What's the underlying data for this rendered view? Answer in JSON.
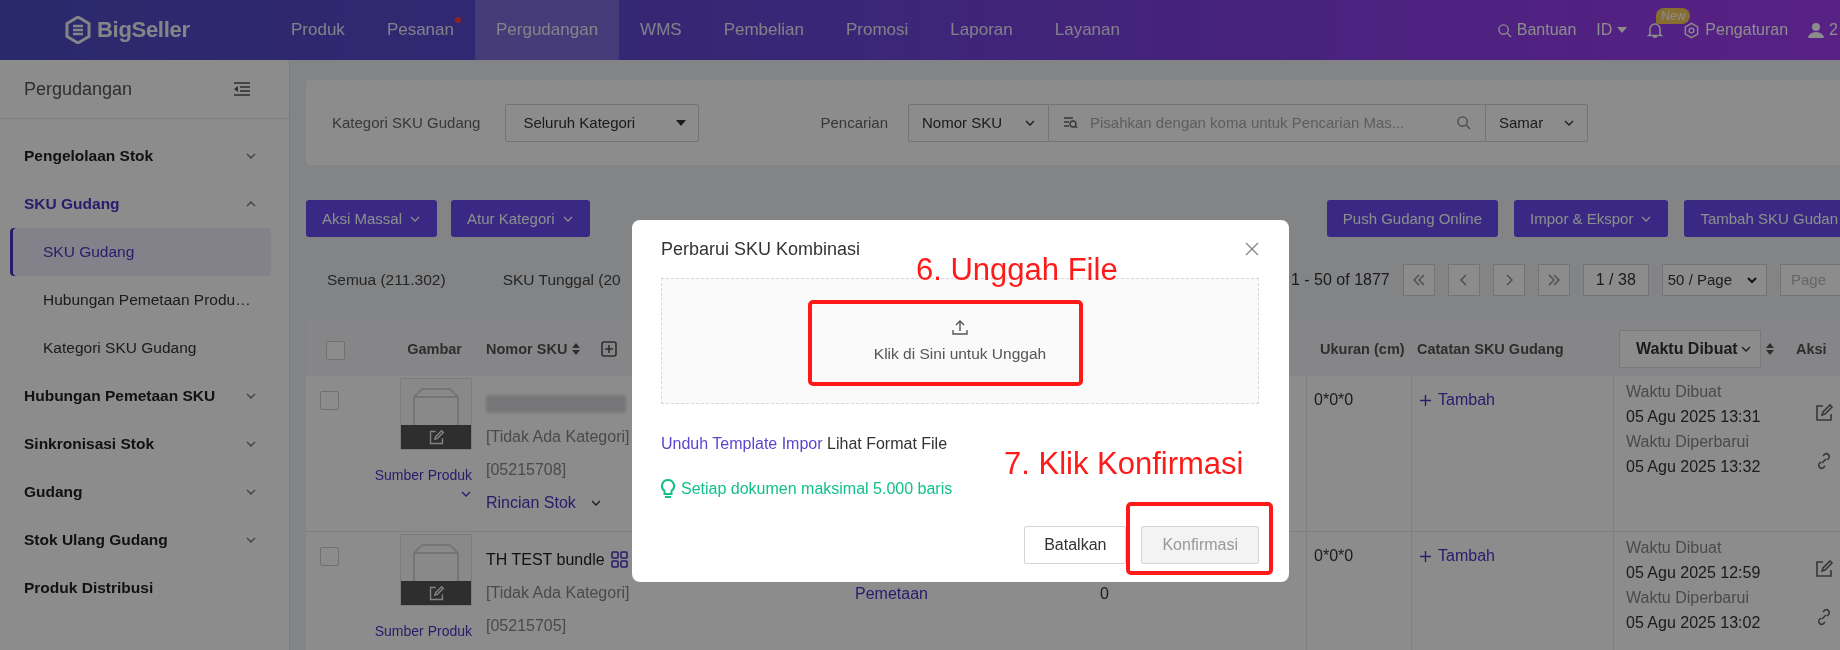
{
  "topbar": {
    "logo": "BigSeller",
    "nav": [
      {
        "label": "Produk",
        "selected": false,
        "dot": false
      },
      {
        "label": "Pesanan",
        "selected": false,
        "dot": true
      },
      {
        "label": "Pergudangan",
        "selected": true,
        "dot": false
      },
      {
        "label": "WMS",
        "selected": false,
        "dot": false
      },
      {
        "label": "Pembelian",
        "selected": false,
        "dot": false
      },
      {
        "label": "Promosi",
        "selected": false,
        "dot": false
      },
      {
        "label": "Laporan",
        "selected": false,
        "dot": false
      },
      {
        "label": "Layanan",
        "selected": false,
        "dot": false
      }
    ],
    "help": "Bantuan",
    "language": "ID",
    "notification_badge": "New",
    "settings": "Pengaturan",
    "user": "2"
  },
  "sidebar": {
    "title": "Pergudangan",
    "items": [
      {
        "label": "Pengelolaan Stok",
        "kind": "group",
        "expanded": false,
        "selected": false
      },
      {
        "label": "SKU Gudang",
        "kind": "group",
        "expanded": true,
        "selected": true,
        "children": [
          {
            "label": "SKU Gudang",
            "selected": true
          },
          {
            "label": "Hubungan Pemetaan Produ…",
            "selected": false
          },
          {
            "label": "Kategori SKU Gudang",
            "selected": false
          }
        ]
      },
      {
        "label": "Hubungan Pemetaan SKU",
        "kind": "group",
        "expanded": false,
        "selected": false
      },
      {
        "label": "Sinkronisasi Stok",
        "kind": "group",
        "expanded": false,
        "selected": false
      },
      {
        "label": "Gudang",
        "kind": "group",
        "expanded": false,
        "selected": false
      },
      {
        "label": "Stok Ulang Gudang",
        "kind": "group",
        "expanded": false,
        "selected": false
      },
      {
        "label": "Produk Distribusi",
        "kind": "link",
        "selected": false
      }
    ]
  },
  "filter": {
    "category": {
      "label": "Kategori SKU Gudang",
      "value": "Seluruh Kategori"
    },
    "search": {
      "label": "Pencarian",
      "field": "Nomor SKU",
      "placeholder": "Pisahkan dengan koma untuk Pencarian Mas...",
      "match": "Samar"
    }
  },
  "toolbar": {
    "left": [
      {
        "label": "Aksi Massal",
        "dropdown": true
      },
      {
        "label": "Atur Kategori",
        "dropdown": true
      }
    ],
    "right": [
      {
        "label": "Push Gudang Online",
        "dropdown": false
      },
      {
        "label": "Impor & Ekspor",
        "dropdown": true
      },
      {
        "label": "Tambah SKU Gudan",
        "dropdown": false
      }
    ]
  },
  "tabs": [
    {
      "label": "Semua (211.302)"
    },
    {
      "label": "SKU Tunggal (20"
    }
  ],
  "pagination": {
    "range": "1 - 50 of 1877",
    "page": "1 / 38",
    "page_size": "50 / Page",
    "jump_placeholder": "Page"
  },
  "table": {
    "all_checked": false,
    "columns": [
      {
        "kind": "image",
        "label": "Gambar",
        "sortable": false
      },
      {
        "kind": "sku",
        "label": "Nomor SKU",
        "sortable": true
      },
      {
        "kind": "size",
        "label": "Ukuran (cm)",
        "sortable": false
      },
      {
        "kind": "note",
        "label": "Catatan SKU Gudang",
        "sortable": false
      },
      {
        "kind": "time",
        "label": "Waktu Dibuat",
        "sortable": true
      },
      {
        "kind": "action",
        "label": "Aksi",
        "sortable": false
      }
    ],
    "rows": [
      {
        "checked": false,
        "source_link": "Sumber Produk",
        "source_expandable": true,
        "category": "[Tidak Ada Kategori]",
        "code": "[05215708]",
        "stock_link": "Rincian Stok",
        "size": "0*0*0",
        "note_action": "Tambah",
        "times": [
          {
            "label": "Waktu Dibuat",
            "value": "05 Agu 2025 13:31"
          },
          {
            "label": "Waktu Diperbarui",
            "value": "05 Agu 2025 13:32"
          }
        ]
      },
      {
        "checked": false,
        "source_link": "Sumber Produk",
        "source_expandable": false,
        "name": "TH TEST bundle",
        "category": "[Tidak Ada Kategori]",
        "code": "[05215705]",
        "column_5": "Pemetaan",
        "column_6": "0",
        "size": "0*0*0",
        "note_action": "Tambah",
        "times": [
          {
            "label": "Waktu Dibuat",
            "value": "05 Agu 2025 12:59"
          },
          {
            "label": "Waktu Diperbarui",
            "value": "05 Agu 2025 13:02"
          }
        ]
      }
    ]
  },
  "modal": {
    "title": "Perbarui SKU Kombinasi",
    "upload_label": "Klik di Sini untuk Unggah",
    "template_link": "Unduh Template Impor",
    "format_link": "Lihat Format File",
    "tip": "Setiap dokumen maksimal 5.000 baris",
    "buttons": [
      {
        "label": "Batalkan",
        "disabled": false
      },
      {
        "label": "Konfirmasi",
        "disabled": true
      }
    ]
  },
  "annotations": [
    {
      "label": "6. Unggah File"
    },
    {
      "label": "7. Klik Konfirmasi"
    }
  ]
}
